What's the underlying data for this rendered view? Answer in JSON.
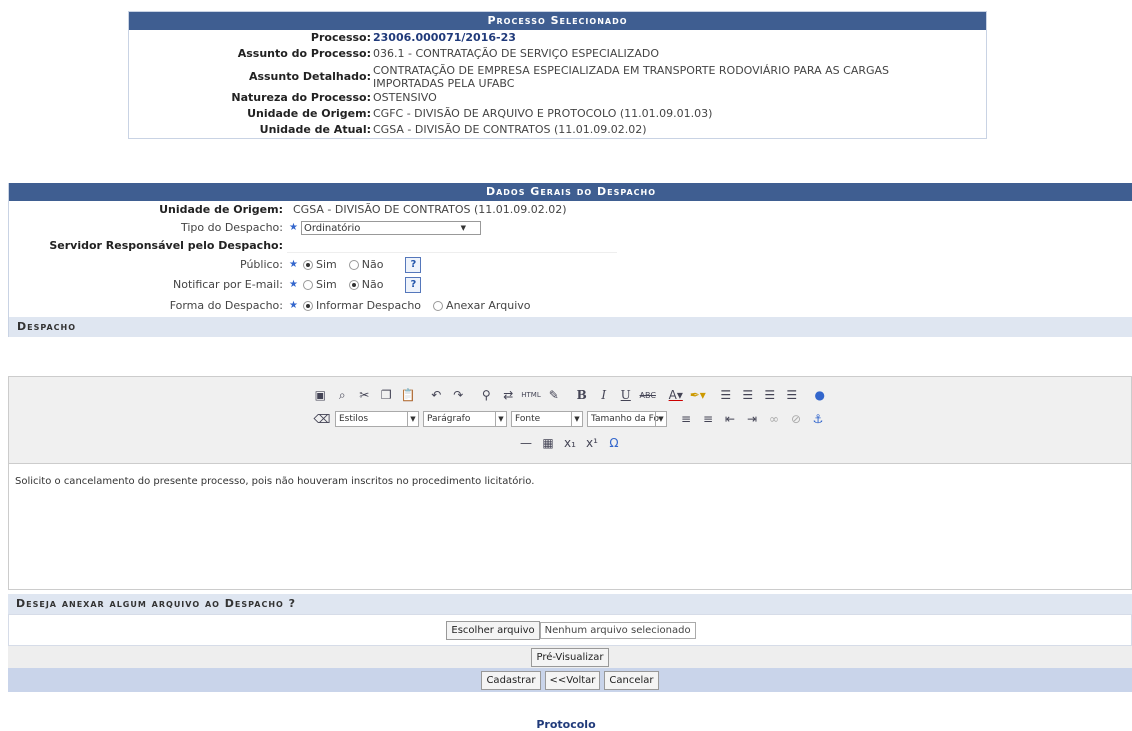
{
  "processo_box": {
    "title": "Processo Selecionado",
    "rows": [
      {
        "label": "Processo:",
        "value": "23006.000071/2016-23"
      },
      {
        "label": "Assunto do Processo:",
        "value": "036.1 - CONTRATAÇÃO DE SERVIÇO ESPECIALIZADO"
      },
      {
        "label": "Assunto Detalhado:",
        "value": "CONTRATAÇÃO DE EMPRESA ESPECIALIZADA EM TRANSPORTE RODOVIÁRIO PARA AS CARGAS IMPORTADAS PELA UFABC"
      },
      {
        "label": "Natureza do Processo:",
        "value": "OSTENSIVO"
      },
      {
        "label": "Unidade de Origem:",
        "value": "CGFC - DIVISÃO DE ARQUIVO E PROTOCOLO (11.01.09.01.03)"
      },
      {
        "label": "Unidade de Atual:",
        "value": "CGSA - DIVISÃO DE CONTRATOS (11.01.09.02.02)"
      }
    ]
  },
  "dados": {
    "title": "Dados Gerais do Despacho",
    "unidade_label": "Unidade de Origem:",
    "unidade_value": "CGSA - DIVISÃO DE CONTRATOS (11.01.09.02.02)",
    "tipo_label": "Tipo do Despacho:",
    "tipo_value": "Ordinatório",
    "servidor_label": "Servidor Responsável pelo Despacho:",
    "publico_label": "Público:",
    "notificar_label": "Notificar por E-mail:",
    "forma_label": "Forma do Despacho:",
    "sim": "Sim",
    "nao": "Não",
    "forma_opt1": "Informar Despacho",
    "forma_opt2": "Anexar Arquivo",
    "help_glyph": "?"
  },
  "despacho": {
    "title": "Despacho",
    "estilos": "Estilos",
    "paragrafo": "Parágrafo",
    "fonte": "Fonte",
    "tamanho": "Tamanho da Fo",
    "text": "Solicito o cancelamento do presente processo, pois não houveram inscritos no procedimento licitatório."
  },
  "anexo": {
    "title": "Deseja anexar algum arquivo ao Despacho ?",
    "choose_button": "Escolher arquivo",
    "no_file": "Nenhum arquivo selecionado",
    "preview_button": "Pré-Visualizar",
    "cadastrar": "Cadastrar",
    "voltar": "<<Voltar",
    "cancelar": "Cancelar"
  },
  "footer": "Protocolo"
}
